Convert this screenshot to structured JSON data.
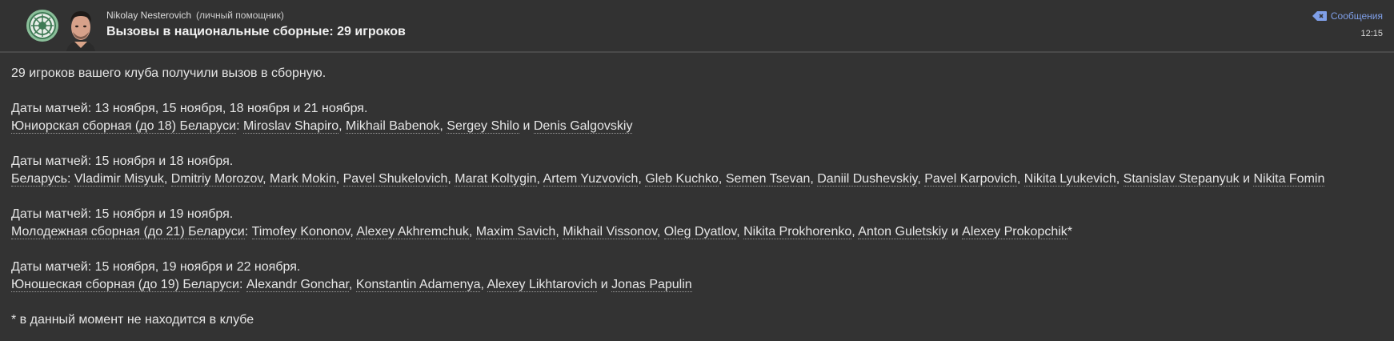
{
  "header": {
    "sender_name": "Nikolay Nesterovich",
    "sender_role": "(личный помощник)",
    "subject": "Вызовы в национальные сборные: 29 игроков",
    "messages_label": "Сообщения",
    "time": "12:15",
    "badge_icon": "club-badge-icon",
    "avatar_icon": "assistant-avatar-icon",
    "messages_icon": "messages-back-icon",
    "accent_color": "#7f9fe8"
  },
  "body": {
    "intro": "29 игроков вашего клуба получили вызов в сборную.",
    "groups": [
      {
        "dates": "Даты матчей: 13 ноября, 15 ноября, 18 ноября и 21 ноября.",
        "team": "Юниорская сборная (до 18) Беларуси",
        "players": [
          "Miroslav Shapiro",
          "Mikhail Babenok",
          "Sergey Shilo",
          "Denis Galgovskiy"
        ],
        "suffix": ""
      },
      {
        "dates": "Даты матчей: 15 ноября и 18 ноября.",
        "team": "Беларусь",
        "players": [
          "Vladimir Misyuk",
          "Dmitriy Morozov",
          "Mark Mokin",
          "Pavel Shukelovich",
          "Marat Koltygin",
          "Artem Yuzvovich",
          "Gleb Kuchko",
          "Semen Tsevan",
          "Daniil Dushevskiy",
          "Pavel Karpovich",
          "Nikita Lyukevich",
          "Stanislav Stepanyuk",
          "Nikita Fomin"
        ],
        "suffix": ""
      },
      {
        "dates": "Даты матчей: 15 ноября и 19 ноября.",
        "team": "Молодежная сборная (до 21) Беларуси",
        "players": [
          "Timofey Kononov",
          "Alexey Akhremchuk",
          "Maxim Savich",
          "Mikhail Vissonov",
          "Oleg Dyatlov",
          "Nikita Prokhorenko",
          "Anton Guletskiy",
          "Alexey Prokopchik"
        ],
        "suffix": "*"
      },
      {
        "dates": "Даты матчей: 15 ноября, 19 ноября и 22 ноября.",
        "team": "Юношеская сборная (до 19) Беларуси",
        "players": [
          "Alexandr Gonchar",
          "Konstantin Adamenya",
          "Alexey Likhtarovich",
          "Jonas Papulin"
        ],
        "suffix": ""
      }
    ],
    "separator": ", ",
    "conjunction": " и ",
    "team_colon": ": ",
    "footnote": "* в данный момент не находится в клубе"
  }
}
